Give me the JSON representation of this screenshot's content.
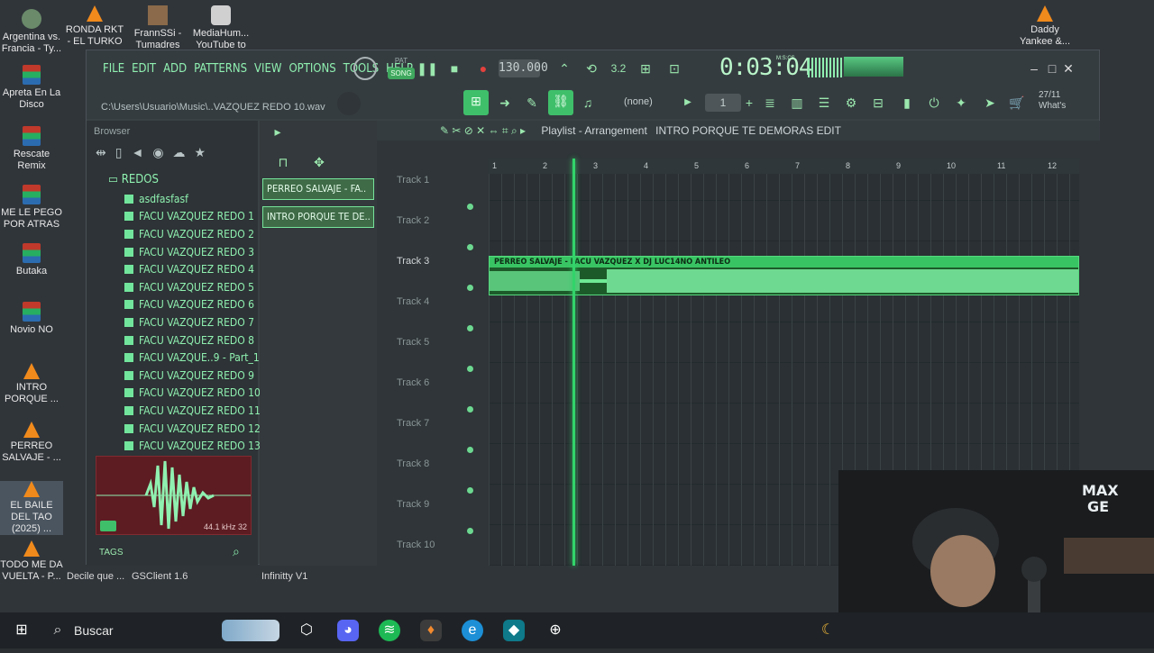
{
  "desktop_icons": [
    {
      "label": "Argentina vs. Francia - Ty...",
      "kind": "img"
    },
    {
      "label": "RONDA RKT - EL TURKO",
      "kind": "vlc"
    },
    {
      "label": "FrannSSi - Tumadres",
      "kind": "img"
    },
    {
      "label": "MediaHum... YouTube to",
      "kind": "app"
    },
    {
      "label": "Daddy Yankee &...",
      "kind": "vlc"
    },
    {
      "label": "Apreta En La Disco",
      "kind": "rar"
    },
    {
      "label": "Rescate Remix",
      "kind": "rar"
    },
    {
      "label": "ME LE PEGO POR ATRAS",
      "kind": "rar"
    },
    {
      "label": "Butaka",
      "kind": "rar"
    },
    {
      "label": "Novio NO",
      "kind": "rar"
    },
    {
      "label": "INTRO PORQUE ...",
      "kind": "vlc"
    },
    {
      "label": "PERREO SALVAJE - ...",
      "kind": "vlc"
    },
    {
      "label": "EL BAILE DEL TAO (2025) ...",
      "kind": "vlc"
    },
    {
      "label": "TODO ME DA VUELTA - P...",
      "kind": "vlc"
    }
  ],
  "desktop_bottom": {
    "a": "Decile que ...",
    "b": "GSClient 1.6",
    "c": "Infinitty V1"
  },
  "fl": {
    "menu": [
      "FILE",
      "EDIT",
      "ADD",
      "PATTERNS",
      "VIEW",
      "OPTIONS",
      "TOOLS",
      "HELP"
    ],
    "pat": "PAT",
    "song": "SONG",
    "tempo": "130.000",
    "time": "0:03:04",
    "mcs": "M:S:CS",
    "path": "C:\\Users\\Usuario\\Music\\..VAZQUEZ REDO 10.wav",
    "none": "(none)",
    "step": "1",
    "news": "27/11 What's"
  },
  "browser": {
    "title": "Browser",
    "folder": "REDOS",
    "files": [
      "asdfasfasf",
      "FACU VAZQUEZ REDO 1",
      "FACU VAZQUEZ REDO 2",
      "FACU VAZQUEZ REDO 3",
      "FACU VAZQUEZ REDO 4",
      "FACU VAZQUEZ REDO 5",
      "FACU VAZQUEZ REDO 6",
      "FACU VAZQUEZ REDO 7",
      "FACU VAZQUEZ REDO 8",
      "FACU VAZQUE..9 - Part_1",
      "FACU VAZQUEZ REDO 9",
      "FACU VAZQUEZ REDO 10",
      "FACU VAZQUEZ REDO 11",
      "FACU VAZQUEZ REDO 12",
      "FACU VAZQUEZ REDO 13"
    ],
    "khz": "44.1 kHz 32",
    "tags": "TAGS"
  },
  "patterns": [
    "PERREO SALVAJE - FA..",
    "INTRO PORQUE TE DE.."
  ],
  "playlist": {
    "title": "Playlist - Arrangement",
    "pattern": "INTRO PORQUE TE DEMORAS EDIT",
    "tracks": [
      "Track 1",
      "Track 2",
      "Track 3",
      "Track 4",
      "Track 5",
      "Track 6",
      "Track 7",
      "Track 8",
      "Track 9",
      "Track 10"
    ],
    "bars": [
      "1",
      "2",
      "3",
      "4",
      "5",
      "6",
      "7",
      "8",
      "9",
      "10",
      "11",
      "12"
    ],
    "clip": "PERREO SALVAJE - FACU VAZQUEZ X DJ LUC14NO ANTILEO"
  },
  "taskbar": {
    "search": "Buscar"
  },
  "colors": {
    "accent": "#8ff0b0",
    "clip": "#39c463",
    "preview": "#5c1c22"
  }
}
